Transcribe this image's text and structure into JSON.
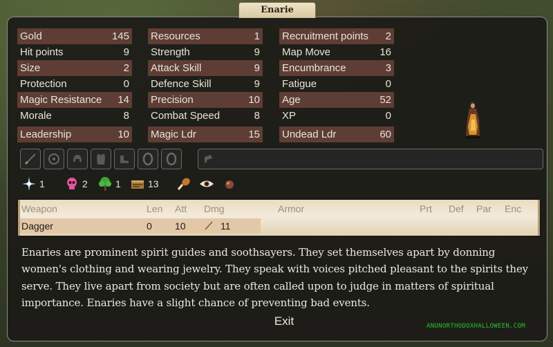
{
  "window": {
    "title": "Enarie"
  },
  "stats": {
    "col1": [
      {
        "label": "Gold",
        "value": "145"
      },
      {
        "label": "Hit points",
        "value": "9"
      },
      {
        "label": "Size",
        "value": "2"
      },
      {
        "label": "Protection",
        "value": "0"
      },
      {
        "label": "Magic Resistance",
        "value": "14"
      },
      {
        "label": "Morale",
        "value": "8"
      },
      {
        "label": "Leadership",
        "value": "10"
      }
    ],
    "col2": [
      {
        "label": "Resources",
        "value": "1"
      },
      {
        "label": "Strength",
        "value": "9"
      },
      {
        "label": "Attack Skill",
        "value": "9"
      },
      {
        "label": "Defence Skill",
        "value": "9"
      },
      {
        "label": "Precision",
        "value": "10"
      },
      {
        "label": "Combat Speed",
        "value": "8"
      },
      {
        "label": "Magic Ldr",
        "value": "15"
      }
    ],
    "col3": [
      {
        "label": "Recruitment points",
        "value": "2"
      },
      {
        "label": "Map Move",
        "value": "16"
      },
      {
        "label": "Encumbrance",
        "value": "3"
      },
      {
        "label": "Fatigue",
        "value": "0"
      },
      {
        "label": "Age",
        "value": "52"
      },
      {
        "label": "XP",
        "value": "0"
      },
      {
        "label": "Undead Ldr",
        "value": "60"
      }
    ]
  },
  "item_slots": [
    "weapon-slot-icon",
    "shield-slot-icon",
    "helmet-slot-icon",
    "armor-slot-icon",
    "boots-slot-icon",
    "ring-slot-icon",
    "ring-slot-icon",
    "misc-slot-icon"
  ],
  "magic": {
    "astral": {
      "icon": "astral-star-icon",
      "value": "1"
    },
    "death": {
      "icon": "death-skull-icon",
      "value": "2"
    },
    "nature": {
      "icon": "nature-tree-icon",
      "value": "1"
    },
    "research": {
      "icon": "research-scroll-icon",
      "value": "13"
    }
  },
  "abilities": [
    "drumstick-icon",
    "eye-icon",
    "orb-icon"
  ],
  "weapons_table": {
    "headers": {
      "weapon": "Weapon",
      "len": "Len",
      "att": "Att",
      "dmg": "Dmg",
      "armor": "Armor",
      "prt": "Prt",
      "def": "Def",
      "par": "Par",
      "enc": "Enc"
    },
    "rows": [
      {
        "weapon": "Dagger",
        "len": "0",
        "att": "10",
        "dmg": "11"
      }
    ]
  },
  "description": "Enaries are prominent spirit guides and soothsayers. They set themselves apart by donning women's clothing and wearing jewelry. They speak with voices pitched pleasant to the spirits they serve. They live apart from society but are often called upon to judge in matters of spiritual importance. Enaries have a slight chance of preventing bad events.",
  "buttons": {
    "exit": "Exit"
  },
  "watermark": "ANUNORTHODOXHALLOWEEN.COM",
  "colors": {
    "panel_bg": "#1c1b18",
    "shaded_row": "#5e3d34",
    "parchment": "#efe3cc",
    "watermark": "#29c42a"
  }
}
